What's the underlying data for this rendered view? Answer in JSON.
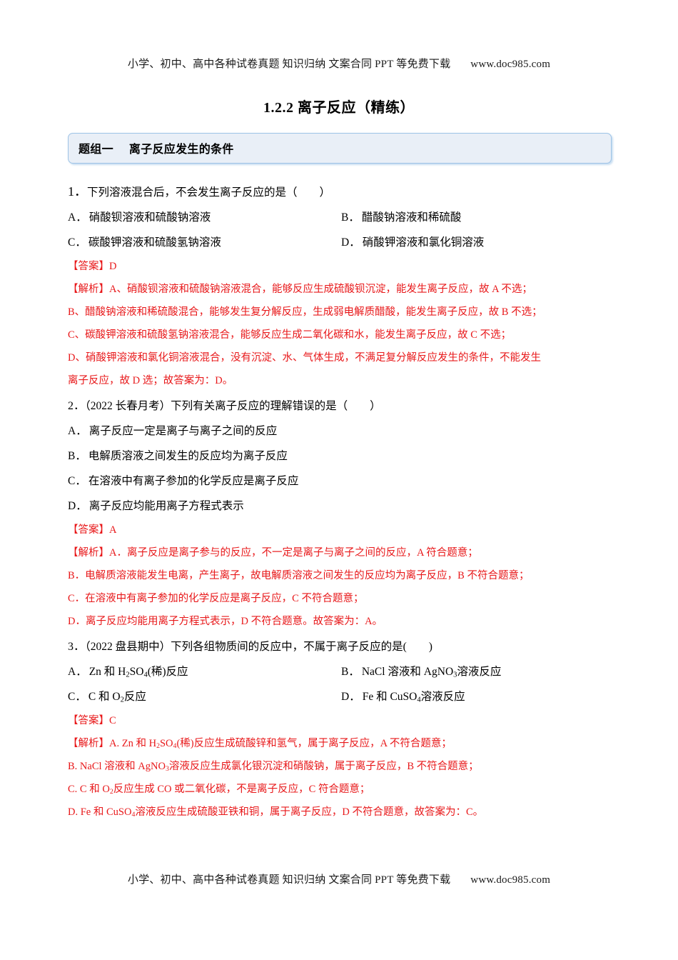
{
  "header": {
    "text": "小学、初中、高中各种试卷真题 知识归纳 文案合同 PPT 等免费下载",
    "url": "www.doc985.com"
  },
  "footer": {
    "text": "小学、初中、高中各种试卷真题 知识归纳 文案合同 PPT 等免费下载",
    "url": "www.doc985.com"
  },
  "title": "1.2.2 离子反应（精练）",
  "section": {
    "group_label": "题组一",
    "group_title": "离子反应发生的条件",
    "box_bg": "#e9eff7",
    "box_border": "#9dc3e6"
  },
  "answer_color": "#e8181a",
  "questions": [
    {
      "number": "1",
      "number_text": "1．",
      "stem": "下列溶液混合后，不会发生离子反应的是（　　）",
      "options": [
        {
          "label": "A．",
          "text": "硝酸钡溶液和硫酸钠溶液"
        },
        {
          "label": "B．",
          "text": "醋酸钠溶液和稀硫酸"
        },
        {
          "label": "C．",
          "text": "碳酸钾溶液和硫酸氢钠溶液"
        },
        {
          "label": "D．",
          "text": "硝酸钾溶液和氯化铜溶液"
        }
      ],
      "answer_tag": "【答案】",
      "answer": "D",
      "analysis_tag": "【解析】",
      "analysis_lines": [
        "A、硝酸钡溶液和硫酸钠溶液混合，能够反应生成硫酸钡沉淀，能发生离子反应，故 A 不选；",
        "B、醋酸钠溶液和稀硫酸混合，能够发生复分解反应，生成弱电解质醋酸，能发生离子反应，故 B 不选；",
        "C、碳酸钾溶液和硫酸氢钠溶液混合，能够反应生成二氧化碳和水，能发生离子反应，故 C 不选；",
        "D、硝酸钾溶液和氯化铜溶液混合，没有沉淀、水、气体生成，不满足复分解反应发生的条件，不能发生",
        "离子反应，故 D 选；故答案为：D。"
      ]
    },
    {
      "number": "2",
      "number_text": "2．",
      "stem": "（2022 长春月考）下列有关离子反应的理解错误的是（　　）",
      "options": [
        {
          "label": "A．",
          "text": "离子反应一定是离子与离子之间的反应"
        },
        {
          "label": "B．",
          "text": "电解质溶液之间发生的反应均为离子反应"
        },
        {
          "label": "C．",
          "text": "在溶液中有离子参加的化学反应是离子反应"
        },
        {
          "label": "D．",
          "text": "离子反应均能用离子方程式表示"
        }
      ],
      "answer_tag": "【答案】",
      "answer": "A",
      "analysis_tag": "【解析】",
      "analysis_lines": [
        "A．离子反应是离子参与的反应，不一定是离子与离子之间的反应，A 符合题意；",
        "B．电解质溶液能发生电离，产生离子，故电解质溶液之间发生的反应均为离子反应，B 不符合题意；",
        "C．在溶液中有离子参加的化学反应是离子反应，C 不符合题意；",
        "D．离子反应均能用离子方程式表示，D 不符合题意。故答案为：A。"
      ]
    },
    {
      "number": "3",
      "number_text": "3．",
      "stem": "（2022 盘县期中）下列各组物质间的反应中，不属于离子反应的是(　　)",
      "answer_tag": "【答案】",
      "answer": "C",
      "analysis_tag": "【解析】"
    }
  ],
  "q3": {
    "opt_a_label": "A．",
    "opt_a_1": "Zn 和 H",
    "opt_a_sub": "2",
    "opt_a_2": "SO",
    "opt_a_sub2": "4",
    "opt_a_3": "(稀)反应",
    "opt_b_label": "B．",
    "opt_b_1": "NaCl 溶液和 AgNO",
    "opt_b_sub": "3",
    "opt_b_2": "溶液反应",
    "opt_c_label": "C．",
    "opt_c_1": "C 和 O",
    "opt_c_sub": "2",
    "opt_c_2": "反应",
    "opt_d_label": "D．",
    "opt_d_1": "Fe 和 CuSO",
    "opt_d_sub": "4",
    "opt_d_2": "溶液反应",
    "an_a_1": "A. Zn 和 H",
    "an_a_sub": "2",
    "an_a_2": "SO",
    "an_a_sub2": "4",
    "an_a_3": "(稀)反应生成硫酸锌和氢气，属于离子反应，A 不符合题意；",
    "an_b_1": "B. NaCl 溶液和 AgNO",
    "an_b_sub": "3",
    "an_b_2": "溶液反应生成氯化银沉淀和硝酸钠，属于离子反应，B 不符合题意；",
    "an_c_1": "C. C 和 O",
    "an_c_sub": "2",
    "an_c_2": "反应生成 CO 或二氧化碳，不是离子反应，C 符合题意；",
    "an_d_1": "D. Fe 和 CuSO",
    "an_d_sub": "4",
    "an_d_2": "溶液反应生成硫酸亚铁和铜，属于离子反应，D 不符合题意，故答案为：C。"
  }
}
